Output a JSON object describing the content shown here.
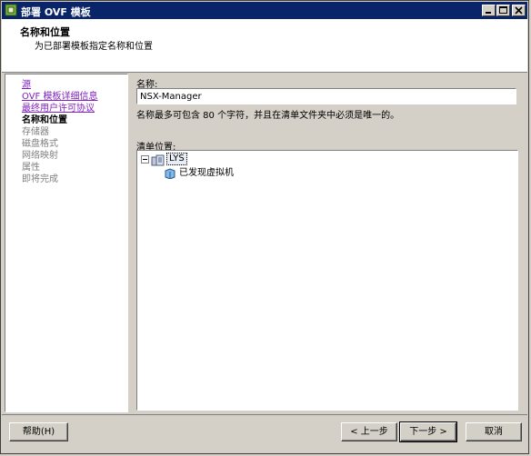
{
  "window": {
    "title": "部署 OVF 模板",
    "controls": {
      "minimize": "minimize-icon",
      "maximize": "maximize-icon",
      "close": "close-icon"
    }
  },
  "header": {
    "title": "名称和位置",
    "subtitle": "为已部署模板指定名称和位置"
  },
  "steps": [
    {
      "label": "源",
      "state": "link"
    },
    {
      "label": "OVF 模板详细信息",
      "state": "link"
    },
    {
      "label": "最终用户许可协议",
      "state": "link"
    },
    {
      "label": "名称和位置",
      "state": "active"
    },
    {
      "label": "存储器",
      "state": "dim"
    },
    {
      "label": "磁盘格式",
      "state": "dim"
    },
    {
      "label": "网络映射",
      "state": "dim"
    },
    {
      "label": "属性",
      "state": "dim"
    },
    {
      "label": "即将完成",
      "state": "dim"
    }
  ],
  "form": {
    "name_label": "名称:",
    "name_value": "NSX-Manager",
    "name_hint": "名称最多可包含 80 个字符，并且在清单文件夹中必须是唯一的。",
    "location_label": "清单位置:"
  },
  "tree": {
    "root": {
      "label": "LYS",
      "icon": "datacenter-icon",
      "expanded": true
    },
    "children": [
      {
        "label": "已发现虚拟机",
        "icon": "folder-icon"
      }
    ]
  },
  "buttons": {
    "help": "帮助(H)",
    "back": "< 上一步",
    "next": "下一步 >",
    "cancel": "取消"
  },
  "colors": {
    "titlebar": "#0a246a",
    "link": "#8020c0",
    "dim": "#808080",
    "face": "#d4d0c8"
  }
}
